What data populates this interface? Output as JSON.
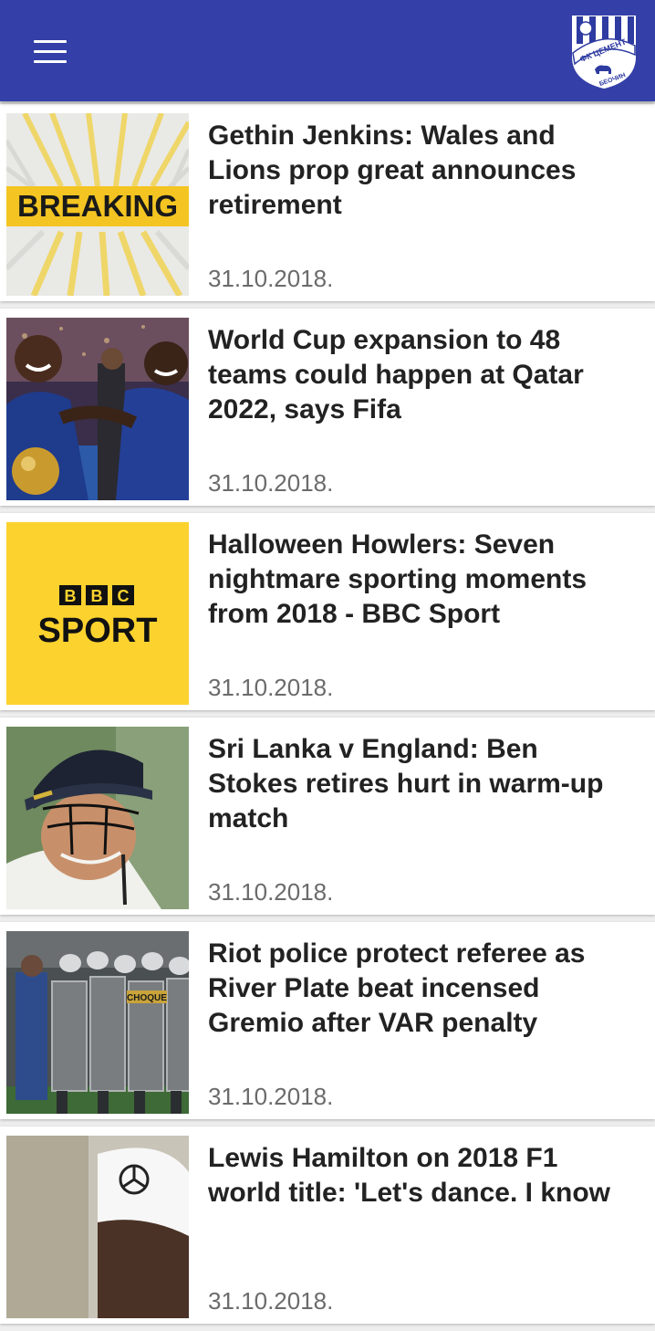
{
  "appbar": {
    "background": "#3440a8",
    "menu_icon": "hamburger-menu-icon",
    "logo": {
      "icon": "club-crest-logo",
      "text_top": "ФК ЦЕМЕНТ",
      "text_bottom": "БЕОЧИН"
    }
  },
  "thumb_labels": {
    "breaking": "BREAKING",
    "bbc_letters": [
      "B",
      "B",
      "C"
    ],
    "sport": "SPORT",
    "riot_shield": "CHOQUE"
  },
  "articles": [
    {
      "title": "Gethin Jenkins: Wales and Lions prop great announces retirement",
      "date": "31.10.2018.",
      "thumbnail": "breaking-news-image"
    },
    {
      "title": "World Cup expansion to 48 teams could happen at Qatar 2022, says Fifa",
      "date": "31.10.2018.",
      "thumbnail": "france-players-photo"
    },
    {
      "title": "Halloween Howlers: Seven nightmare sporting moments from 2018 - BBC Sport",
      "date": "31.10.2018.",
      "thumbnail": "bbc-sport-logo-image"
    },
    {
      "title": "Sri Lanka v England: Ben Stokes retires hurt in warm-up match",
      "date": "31.10.2018.",
      "thumbnail": "cricketer-helmet-photo"
    },
    {
      "title": "Riot police protect referee as River Plate beat incensed Gremio after VAR penalty",
      "date": "31.10.2018.",
      "thumbnail": "riot-police-photo"
    },
    {
      "title": "Lewis Hamilton on 2018 F1 world title: 'Let's dance. I know",
      "date": "31.10.2018.",
      "thumbnail": "hamilton-photo"
    }
  ]
}
